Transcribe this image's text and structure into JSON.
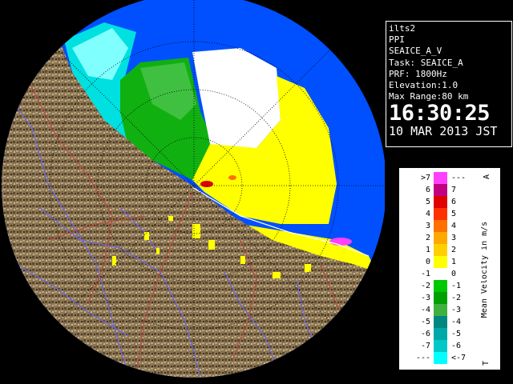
{
  "info": {
    "site": "ilts2",
    "product": "PPI",
    "scan": "SEAICE_A_V",
    "task": "Task: SEAICE_A",
    "prf": "PRF: 1800Hz",
    "elevation": "Elevation:1.0",
    "max_range": "Max Range:80 km",
    "time": "16:30:25",
    "date": "10 MAR 2013 JST"
  },
  "legend": {
    "axis_label": "Mean Velocity in m/s",
    "top_letter": "A",
    "bottom_letter": "T",
    "rows": [
      {
        "left": ">7",
        "right": "---",
        "color": "#ff40ff"
      },
      {
        "left": "6",
        "right": "7",
        "color": "#c00080"
      },
      {
        "left": "5",
        "right": "6",
        "color": "#e00000"
      },
      {
        "left": "4",
        "right": "5",
        "color": "#ff3000"
      },
      {
        "left": "3",
        "right": "4",
        "color": "#ff7000"
      },
      {
        "left": "2",
        "right": "3",
        "color": "#ffa800"
      },
      {
        "left": "1",
        "right": "2",
        "color": "#ffd000"
      },
      {
        "left": "0",
        "right": "1",
        "color": "#ffff00"
      },
      {
        "left": "-1",
        "right": "0",
        "color": "#ffffff"
      },
      {
        "left": "-2",
        "right": "-1",
        "color": "#00c800"
      },
      {
        "left": "-3",
        "right": "-2",
        "color": "#00a000"
      },
      {
        "left": "-4",
        "right": "-3",
        "color": "#40b040"
      },
      {
        "left": "-5",
        "right": "-4",
        "color": "#008880"
      },
      {
        "left": "-6",
        "right": "-5",
        "color": "#00a8a8"
      },
      {
        "left": "-7",
        "right": "-6",
        "color": "#00c8c8"
      },
      {
        "left": "---",
        "right": "<-7",
        "color": "#00ffff"
      }
    ]
  },
  "colors": {
    "range_ring": "#0050ff",
    "land": "#8a7450",
    "river": "#6060ff",
    "road": "#c04040"
  }
}
